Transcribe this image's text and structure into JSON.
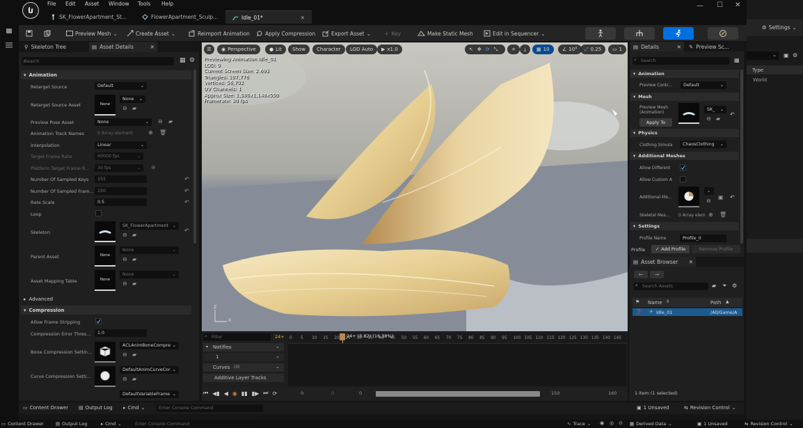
{
  "menu": [
    "File",
    "Edit",
    "Asset",
    "Window",
    "Tools",
    "Help"
  ],
  "tabs": [
    {
      "label": "SK_FlowerApartment_St..."
    },
    {
      "label": "FlowerApartment_Sculp..."
    },
    {
      "label": "Idle_01*"
    }
  ],
  "toolbar": {
    "preview_mesh": "Preview Mesh",
    "create_asset": "Create Asset",
    "reimport": "Reimport Animation",
    "apply_compression": "Apply Compression",
    "export_asset": "Export Asset",
    "key": "Key",
    "make_static": "Make Static Mesh",
    "edit_sequencer": "Edit in Sequencer"
  },
  "right_window": {
    "settings": "Settings",
    "col_type": "Type",
    "item_world": "World"
  },
  "left_panel": {
    "tab_skeleton": "Skeleton Tree",
    "tab_details": "Asset Details",
    "search_placeholder": "Search",
    "sec_animation": "Animation",
    "retarget_source_label": "Retarget Source",
    "retarget_source_value": "Default",
    "retarget_source_asset_label": "Retarget Source Asset",
    "retarget_source_asset_value": "None",
    "thumb_none": "None",
    "preview_pose_label": "Preview Pose Asset",
    "preview_pose_value": "None",
    "track_names_label": "Animation Track Names",
    "track_names_value": "0 Array element",
    "interp_label": "Interpolation",
    "interp_value": "Linear",
    "target_rate_label": "Target Frame Rate",
    "target_rate_value": "60000 fps",
    "platform_rate_label": "Platform Target Frame R...",
    "platform_rate_value": "30 fps",
    "sampled_keys_label": "Number Of Sampled Keys",
    "sampled_keys_value": "151",
    "sampled_frames_label": "Number Of Sampled Fram...",
    "sampled_frames_value": "150",
    "rate_scale_label": "Rate Scale",
    "rate_scale_value": "0.5",
    "loop_label": "Loop",
    "skeleton_label": "Skeleton",
    "skeleton_value": "SK_FlowerApartment",
    "parent_label": "Parent Asset",
    "parent_value": "None",
    "mapping_label": "Asset Mapping Table",
    "mapping_value": "None",
    "sec_advanced": "Advanced",
    "sec_compression": "Compression",
    "allow_strip_label": "Allow Frame Stripping",
    "comp_thresh_label": "Compression Error Thres...",
    "comp_thresh_value": "1.0",
    "bone_comp_label": "Bone Compression Settin...",
    "bone_comp_value": "ACLAnimBoneCompre",
    "curve_comp_label": "Curve Compression Setti...",
    "curve_comp_value": "DefaultAnimCurveCor",
    "var_frame_value": "DefaultVariableFrame"
  },
  "viewport": {
    "perspective": "Perspective",
    "lit": "Lit",
    "show": "Show",
    "character": "Character",
    "lod": "LOD Auto",
    "speed": "x1.0",
    "grid": "10",
    "angle": "10°",
    "scale": "0.25",
    "cam": "1",
    "stats": [
      "Previewing Animation Idle_01",
      "LOD: 0",
      "Current Screen Size: 2.693",
      "Triangles: 107,776",
      "Vertices: 56,702",
      "UV Channels: 1",
      "Approx Size: 1,580x1,148x550",
      "Framerate: 30 fps"
    ],
    "axis_z": "Z",
    "axis_x": "X"
  },
  "timeline": {
    "filter_placeholder": "Filter",
    "frame_badge": "24+",
    "playhead": "24+ (0.82) (16.38%)",
    "notifies": "Notifies",
    "notify_track": "1",
    "curves": "Curves",
    "curves_count": "(0)",
    "additive": "Additive Layer Tracks",
    "ticks": [
      "0",
      "5",
      "10",
      "15",
      "20",
      "25",
      "30",
      "35",
      "40",
      "45",
      "50",
      "55",
      "60",
      "65",
      "70",
      "75",
      "80",
      "85",
      "90",
      "95",
      "100",
      "105",
      "110",
      "115",
      "120",
      "125",
      "130",
      "135",
      "140",
      "145"
    ],
    "range_start": "0",
    "range_cur": "0",
    "range_zero": "0",
    "range_end": "150",
    "range_max": "160"
  },
  "details": {
    "tab_details": "Details",
    "tab_preview": "Preview Sc...",
    "search_placeholder": "Search",
    "sec_animation": "Animation",
    "preview_ctrl_label": "Preview Contr...",
    "preview_ctrl_value": "Default",
    "sec_mesh": "Mesh",
    "preview_mesh_label": "Preview Mesh (Animation)",
    "preview_mesh_value": "SK_",
    "apply_to": "Apply To",
    "sec_physics": "Physics",
    "clothing_label": "Clothing Simula",
    "clothing_value": "ChaosClothing",
    "sec_additional": "Additional Meshes",
    "allow_diff_label": "Allow Different",
    "allow_custom_label": "Allow Custom A",
    "additional_label": "Additional Me...",
    "skeletal_label": "Skeletal Mes...",
    "skeletal_value": "0 Array elem",
    "sec_settings": "Settings",
    "profile_name_label": "Profile Name",
    "profile_name_value": "Profile_0",
    "profile_label": "Profile",
    "add_profile": "Add Profile",
    "remove_profile": "Remove Profile"
  },
  "asset_browser": {
    "title": "Asset Browser",
    "search_placeholder": "Search Assets",
    "col_name": "Name",
    "col_path": "Path",
    "item_name": "Idle_01",
    "item_path": "/All/Game/A",
    "selection": "1 item (1 selected)"
  },
  "status_bar": {
    "content_drawer": "Content Drawer",
    "output_log": "Output Log",
    "cmd": "Cmd",
    "console_placeholder": "Enter Console Command",
    "unsaved": "1 Unsaved",
    "revision": "Revision Control"
  },
  "bottom_bar": {
    "content_drawer": "Content Drawer",
    "output_log": "Output Log",
    "cmd": "Cmd",
    "console_placeholder": "Enter Console Command",
    "trace": "Trace",
    "derived": "Derived Data",
    "unsaved": "1 Unsaved",
    "revision": "Revision Control"
  },
  "colors": {
    "accent": "#0070e0",
    "selection": "#1d5a8f",
    "warning": "#e2b53a"
  }
}
